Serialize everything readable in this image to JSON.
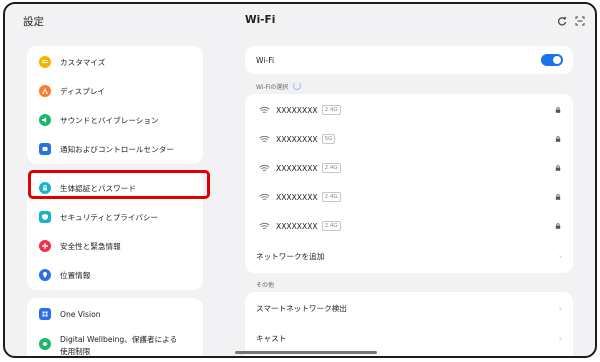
{
  "left": {
    "title": "設定",
    "group1": [
      {
        "label": "カスタマイズ",
        "icon": "palette-icon",
        "color": "#f5b400"
      },
      {
        "label": "ディスプレイ",
        "icon": "display-icon",
        "color": "#ff7a2b"
      },
      {
        "label": "サウンドとバイブレーション",
        "icon": "sound-icon",
        "color": "#1fb86b"
      },
      {
        "label": "通知およびコントロールセンター",
        "icon": "notification-icon",
        "color": "#2b6fe8"
      }
    ],
    "group2": [
      {
        "label": "生体認証とパスワード",
        "icon": "lock-icon",
        "color": "#12b5cb"
      },
      {
        "label": "セキュリティとプライバシー",
        "icon": "shield-icon",
        "color": "#12b5cb"
      },
      {
        "label": "安全性と緊急情報",
        "icon": "emergency-icon",
        "color": "#f0324b"
      },
      {
        "label": "位置情報",
        "icon": "location-icon",
        "color": "#2b6fe8"
      }
    ],
    "group3": [
      {
        "label": "One Vision",
        "icon": "one-vision-icon",
        "color": "#2b6fe8"
      },
      {
        "label": "Digital Wellbeing、保護者による",
        "label2": "使用制限",
        "icon": "wellbeing-icon",
        "color": "#1fb86b"
      }
    ]
  },
  "right": {
    "title": "Wi-Fi",
    "wifi_toggle_label": "Wi-Fi",
    "wifi_enabled": true,
    "select_label": "Wi-Fiの選択",
    "networks": [
      {
        "ssid": "XXXXXXXX",
        "band": "2.4G"
      },
      {
        "ssid": "XXXXXXXX",
        "band": "5G"
      },
      {
        "ssid": "XXXXXXXX",
        "band": "2.4G"
      },
      {
        "ssid": "XXXXXXXX",
        "band": "2.4G"
      },
      {
        "ssid": "XXXXXXXX",
        "band": "2.4G"
      }
    ],
    "add_network": "ネットワークを追加",
    "other_label": "その他",
    "smart_network": "スマートネットワーク検出",
    "cast": "キャスト"
  },
  "colors": {
    "accent": "#1a73e8",
    "highlight": "#e00000",
    "background": "#f2f2f4"
  }
}
